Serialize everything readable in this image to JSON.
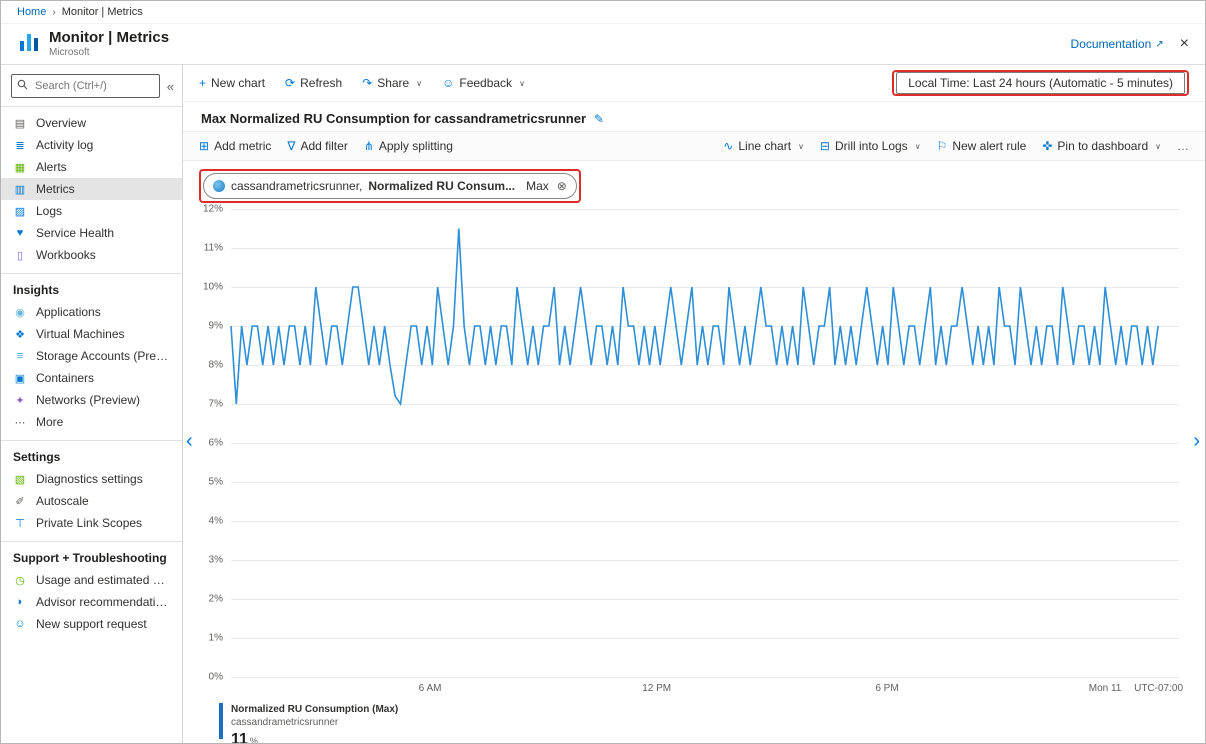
{
  "breadcrumb": {
    "home": "Home",
    "current": "Monitor | Metrics"
  },
  "header": {
    "title": "Monitor | Metrics",
    "subtitle": "Microsoft",
    "documentation": "Documentation",
    "close": "×"
  },
  "icons": {
    "external": "↗",
    "collapse": "«",
    "caret": "∨",
    "edit": "✎",
    "remove": "⊗",
    "left": "‹",
    "right": "›",
    "breadcrumb_sep": "›"
  },
  "sidebar": {
    "search_placeholder": "Search (Ctrl+/)",
    "items": [
      {
        "type": "item",
        "label": "Overview",
        "glyph": "▤",
        "color": "#605e5c"
      },
      {
        "type": "item",
        "label": "Activity log",
        "glyph": "≣",
        "color": "#0078d4"
      },
      {
        "type": "item",
        "label": "Alerts",
        "glyph": "▦",
        "color": "#5db300"
      },
      {
        "type": "item",
        "label": "Metrics",
        "glyph": "▥",
        "color": "#0078d4",
        "selected": true
      },
      {
        "type": "item",
        "label": "Logs",
        "glyph": "▨",
        "color": "#0078d4"
      },
      {
        "type": "item",
        "label": "Service Health",
        "glyph": "♥",
        "color": "#0078d4"
      },
      {
        "type": "item",
        "label": "Workbooks",
        "glyph": "▯",
        "color": "#8661c5"
      },
      {
        "type": "section",
        "label": "Insights"
      },
      {
        "type": "item",
        "label": "Applications",
        "glyph": "◉",
        "color": "#68b7dc"
      },
      {
        "type": "item",
        "label": "Virtual Machines",
        "glyph": "❖",
        "color": "#0078d4"
      },
      {
        "type": "item",
        "label": "Storage Accounts (Preview)",
        "glyph": "≡",
        "color": "#32a8dd"
      },
      {
        "type": "item",
        "label": "Containers",
        "glyph": "▣",
        "color": "#0078d4"
      },
      {
        "type": "item",
        "label": "Networks (Preview)",
        "glyph": "✦",
        "color": "#8661c5"
      },
      {
        "type": "item",
        "label": "More",
        "glyph": "⋯",
        "color": "#605e5c"
      },
      {
        "type": "section",
        "label": "Settings"
      },
      {
        "type": "item",
        "label": "Diagnostics settings",
        "glyph": "▧",
        "color": "#5db300"
      },
      {
        "type": "item",
        "label": "Autoscale",
        "glyph": "✐",
        "color": "#605e5c"
      },
      {
        "type": "item",
        "label": "Private Link Scopes",
        "glyph": "⊤",
        "color": "#0078d4"
      },
      {
        "type": "section",
        "label": "Support + Troubleshooting"
      },
      {
        "type": "item",
        "label": "Usage and estimated costs",
        "glyph": "◷",
        "color": "#5db300"
      },
      {
        "type": "item",
        "label": "Advisor recommendations",
        "glyph": "◗",
        "color": "#0078d4"
      },
      {
        "type": "item",
        "label": "New support request",
        "glyph": "☺",
        "color": "#0078d4"
      }
    ]
  },
  "commandbar": {
    "left": [
      {
        "glyph": "+",
        "color": "#0078d4",
        "label": "New chart"
      },
      {
        "glyph": "⟳",
        "color": "#0078d4",
        "label": "Refresh"
      },
      {
        "glyph": "↷",
        "color": "#0078d4",
        "label": "Share",
        "caret": true
      },
      {
        "glyph": "☺",
        "color": "#0078d4",
        "label": "Feedback",
        "caret": true
      }
    ],
    "time_button": "Local Time: Last 24 hours (Automatic - 5 minutes)"
  },
  "chart_header": {
    "title": "Max Normalized RU Consumption for cassandrametricsrunner"
  },
  "chart_toolbar": {
    "left": [
      {
        "glyph": "⊞",
        "color": "#0078d4",
        "label": "Add metric"
      },
      {
        "glyph": "∇",
        "color": "#0078d4",
        "label": "Add filter"
      },
      {
        "glyph": "⋔",
        "color": "#0078d4",
        "label": "Apply splitting"
      }
    ],
    "right": [
      {
        "glyph": "∿",
        "color": "#0078d4",
        "label": "Line chart",
        "caret": true
      },
      {
        "glyph": "⊟",
        "color": "#0078d4",
        "label": "Drill into Logs",
        "caret": true
      },
      {
        "glyph": "⚐",
        "color": "#0078d4",
        "label": "New alert rule"
      },
      {
        "glyph": "✜",
        "color": "#0078d4",
        "label": "Pin to dashboard",
        "caret": true
      },
      {
        "glyph": "…",
        "color": "#605e5c",
        "label": ""
      }
    ]
  },
  "metric_pill": {
    "scope": "cassandrametricsrunner, ",
    "metric": "Normalized RU Consum...",
    "aggregation": "Max"
  },
  "chart_data": {
    "type": "line",
    "title": "Max Normalized RU Consumption for cassandrametricsrunner",
    "time_range": "Last 24 hours (Automatic - 5 minutes)",
    "ylim": [
      0,
      12
    ],
    "y_step": 1,
    "y_unit": "%",
    "grid": true,
    "timezone": "UTC-07:00",
    "x_ticks": [
      {
        "label": "6 AM",
        "pos": 0.21
      },
      {
        "label": "12 PM",
        "pos": 0.449
      },
      {
        "label": "6 PM",
        "pos": 0.692
      },
      {
        "label": "Mon 11",
        "pos": 0.922
      }
    ],
    "series": [
      {
        "name": "Normalized RU Consumption (Max)",
        "resource": "cassandrametricsrunner",
        "aggregation": "Max",
        "color": "#2e8fd6",
        "values": [
          9,
          7,
          9,
          8,
          9,
          9,
          8,
          9,
          8,
          9,
          8,
          9,
          9,
          8,
          9,
          8,
          10,
          9,
          8,
          9,
          9,
          8,
          9,
          10,
          10,
          9,
          8,
          9,
          8,
          9,
          8,
          7.2,
          7,
          8,
          9,
          9,
          8,
          9,
          8,
          10,
          9,
          8,
          9,
          11.5,
          9,
          8,
          9,
          9,
          8,
          9,
          8,
          9,
          9,
          8,
          10,
          9,
          8,
          9,
          8,
          9,
          9,
          10,
          8,
          9,
          8,
          9,
          10,
          9,
          8,
          9,
          9,
          8,
          9,
          8,
          10,
          9,
          9,
          8,
          9,
          8,
          9,
          8,
          9,
          10,
          9,
          8,
          9,
          10,
          8,
          9,
          8,
          9,
          9,
          8,
          10,
          9,
          8,
          9,
          8,
          9,
          10,
          9,
          9,
          8,
          9,
          8,
          9,
          8,
          10,
          9,
          8,
          9,
          9,
          10,
          8,
          9,
          8,
          9,
          8,
          9,
          10,
          9,
          8,
          9,
          8,
          10,
          9,
          8,
          9,
          9,
          8,
          9,
          10,
          8,
          9,
          8,
          9,
          9,
          10,
          9,
          8,
          9,
          8,
          9,
          8,
          10,
          9,
          9,
          8,
          10,
          9,
          8,
          9,
          8,
          9,
          9,
          8,
          10,
          9,
          8,
          9,
          9,
          8,
          9,
          8,
          10,
          9,
          8,
          9,
          8,
          9,
          9,
          8,
          9,
          8,
          9
        ]
      }
    ]
  },
  "legend": {
    "metric": "Normalized RU Consumption (Max)",
    "resource": "cassandrametricsrunner",
    "value": "11",
    "unit": "%",
    "color": "#1b6ec2"
  },
  "highlight_color": "#e02b2b"
}
